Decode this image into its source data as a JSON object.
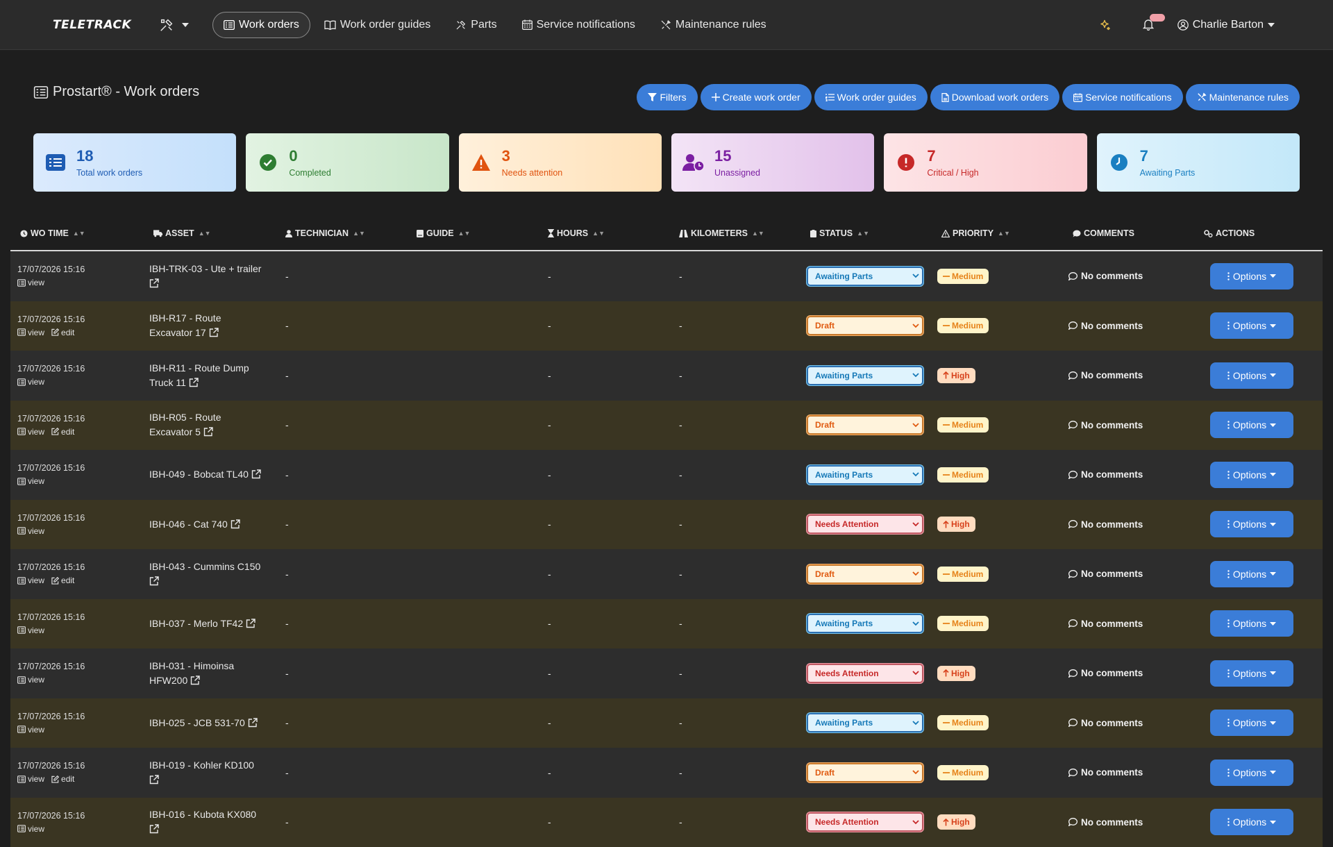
{
  "nav": {
    "logo": "TELETRACK",
    "items": [
      {
        "label": "Work orders",
        "icon": "list-icon"
      },
      {
        "label": "Work order guides",
        "icon": "book-icon"
      },
      {
        "label": "Parts",
        "icon": "tools-icon"
      },
      {
        "label": "Service notifications",
        "icon": "calendar-icon"
      },
      {
        "label": "Maintenance rules",
        "icon": "wrench-icon"
      }
    ],
    "user": "Charlie Barton"
  },
  "page": {
    "title": "Prostart® - Work orders",
    "actions": [
      "Filters",
      "Create work order",
      "Work order guides",
      "Download work orders",
      "Service notifications",
      "Maintenance rules"
    ]
  },
  "stats": [
    {
      "value": "18",
      "label": "Total work orders"
    },
    {
      "value": "0",
      "label": "Completed"
    },
    {
      "value": "3",
      "label": "Needs attention"
    },
    {
      "value": "15",
      "label": "Unassigned"
    },
    {
      "value": "7",
      "label": "Critical / High"
    },
    {
      "value": "7",
      "label": "Awaiting Parts"
    }
  ],
  "table": {
    "headers": [
      "WO TIME",
      "ASSET",
      "TECHNICIAN",
      "GUIDE",
      "HOURS",
      "KILOMETERS",
      "STATUS",
      "PRIORITY",
      "COMMENTS",
      "ACTIONS"
    ],
    "view_label": "view",
    "edit_label": "edit",
    "comments_label": "No comments",
    "options_label": "Options",
    "rows": [
      {
        "time": "17/07/2026 15:16",
        "asset": "IBH-TRK-03 - Ute + trailer",
        "technician": "-",
        "guide": "",
        "hours": "-",
        "km": "-",
        "status": "Awaiting Parts",
        "priority": "Medium",
        "edit": false
      },
      {
        "time": "17/07/2026 15:16",
        "asset": "IBH-R17 - Route Excavator 17",
        "technician": "-",
        "guide": "",
        "hours": "-",
        "km": "-",
        "status": "Draft",
        "priority": "Medium",
        "edit": true
      },
      {
        "time": "17/07/2026 15:16",
        "asset": "IBH-R11 - Route Dump Truck 11",
        "technician": "-",
        "guide": "",
        "hours": "-",
        "km": "-",
        "status": "Awaiting Parts",
        "priority": "High",
        "edit": false
      },
      {
        "time": "17/07/2026 15:16",
        "asset": "IBH-R05 - Route Excavator 5",
        "technician": "-",
        "guide": "",
        "hours": "-",
        "km": "-",
        "status": "Draft",
        "priority": "Medium",
        "edit": true
      },
      {
        "time": "17/07/2026 15:16",
        "asset": "IBH-049 - Bobcat TL40",
        "technician": "-",
        "guide": "",
        "hours": "-",
        "km": "-",
        "status": "Awaiting Parts",
        "priority": "Medium",
        "edit": false
      },
      {
        "time": "17/07/2026 15:16",
        "asset": "IBH-046 - Cat 740",
        "technician": "-",
        "guide": "",
        "hours": "-",
        "km": "-",
        "status": "Needs Attention",
        "priority": "High",
        "edit": false
      },
      {
        "time": "17/07/2026 15:16",
        "asset": "IBH-043 - Cummins C150",
        "technician": "-",
        "guide": "",
        "hours": "-",
        "km": "-",
        "status": "Draft",
        "priority": "Medium",
        "edit": true
      },
      {
        "time": "17/07/2026 15:16",
        "asset": "IBH-037 - Merlo TF42",
        "technician": "-",
        "guide": "",
        "hours": "-",
        "km": "-",
        "status": "Awaiting Parts",
        "priority": "Medium",
        "edit": false
      },
      {
        "time": "17/07/2026 15:16",
        "asset": "IBH-031 - Himoinsa HFW200",
        "technician": "-",
        "guide": "",
        "hours": "-",
        "km": "-",
        "status": "Needs Attention",
        "priority": "High",
        "edit": false
      },
      {
        "time": "17/07/2026 15:16",
        "asset": "IBH-025 - JCB 531-70",
        "technician": "-",
        "guide": "",
        "hours": "-",
        "km": "-",
        "status": "Awaiting Parts",
        "priority": "Medium",
        "edit": false
      },
      {
        "time": "17/07/2026 15:16",
        "asset": "IBH-019 - Kohler KD100",
        "technician": "-",
        "guide": "",
        "hours": "-",
        "km": "-",
        "status": "Draft",
        "priority": "Medium",
        "edit": true
      },
      {
        "time": "17/07/2026 15:16",
        "asset": "IBH-016 - Kubota KX080",
        "technician": "-",
        "guide": "",
        "hours": "-",
        "km": "-",
        "status": "Needs Attention",
        "priority": "High",
        "edit": false
      }
    ]
  },
  "colors": {
    "primary": "#3b7dd8",
    "background": "#1e1e1e",
    "navbar": "#2b2b2b",
    "row_alt": "#3a3522"
  }
}
